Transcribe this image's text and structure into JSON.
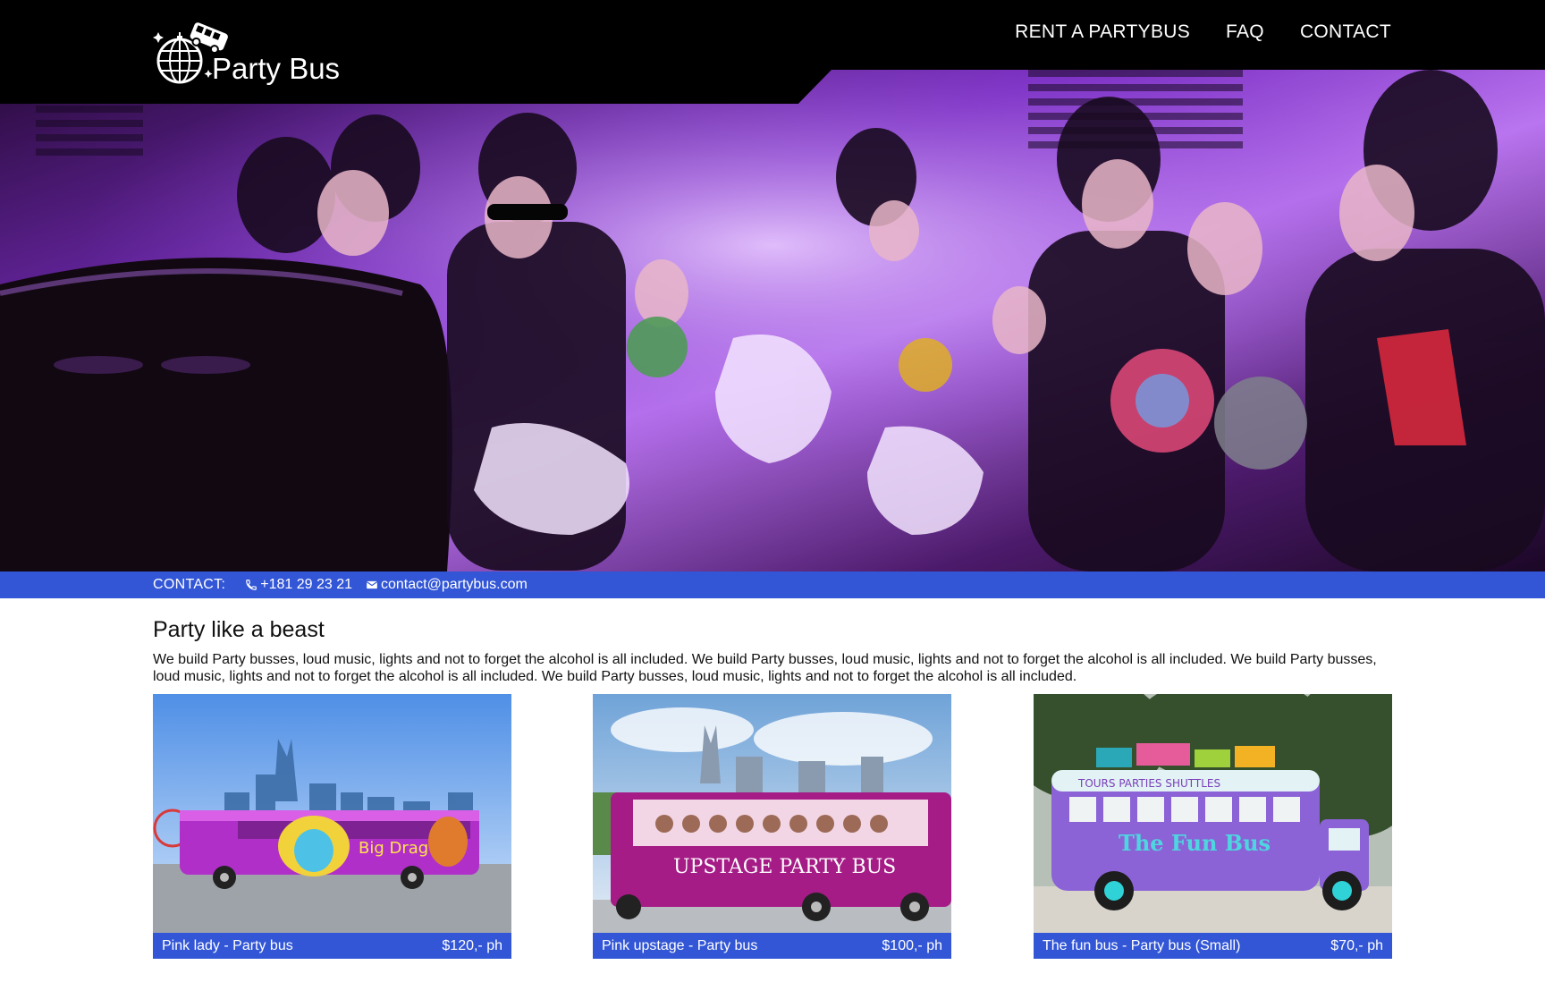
{
  "brand": {
    "name": "Party Bus",
    "logo_icon": "disco-ball-bus-icon"
  },
  "nav": {
    "items": [
      {
        "label": "RENT A PARTYBUS"
      },
      {
        "label": "FAQ"
      },
      {
        "label": "CONTACT"
      }
    ]
  },
  "hero": {
    "image": "party-bus-interior-photo"
  },
  "contact": {
    "label": "CONTACT:",
    "phone": "+181 29 23 21",
    "email": "contact@partybus.com",
    "phone_icon": "phone-icon",
    "email_icon": "envelope-icon"
  },
  "intro": {
    "title": "Party like a beast",
    "text": "We build Party busses, loud music, lights and not to forget the alcohol is all included. We build Party busses, loud music, lights and not to forget the alcohol is all included. We build Party busses, loud music, lights and not to forget the alcohol is all included. We build Party busses, loud music, lights and not to forget the alcohol is all included."
  },
  "buses": [
    {
      "name": "Pink lady - Party bus",
      "price": "$120,- ph",
      "photo": "pink-lady-bus-photo"
    },
    {
      "name": "Pink upstage - Party bus",
      "price": "$100,- ph",
      "photo": "pink-upstage-bus-photo"
    },
    {
      "name": "The fun bus - Party bus (Small)",
      "price": "$70,- ph",
      "photo": "fun-bus-photo"
    }
  ],
  "colors": {
    "header_bg": "#000000",
    "accent_blue": "#3256d6",
    "text": "#111111"
  }
}
